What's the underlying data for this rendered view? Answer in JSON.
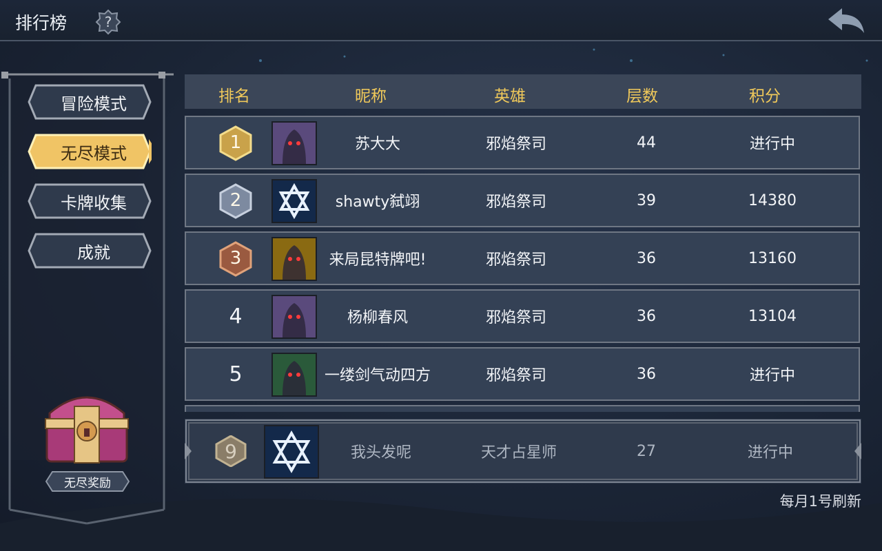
{
  "header": {
    "title": "排行榜",
    "help_icon": "question-gear-icon",
    "back_icon": "back-arrow-icon"
  },
  "sidebar": {
    "items": [
      {
        "label": "冒险模式",
        "active": false
      },
      {
        "label": "无尽模式",
        "active": true
      },
      {
        "label": "卡牌收集",
        "active": false
      },
      {
        "label": "成就",
        "active": false
      }
    ],
    "reward_label": "无尽奖励"
  },
  "table": {
    "columns": [
      "排名",
      "昵称",
      "英雄",
      "层数",
      "积分"
    ],
    "rows": [
      {
        "rank": "1",
        "nickname": "苏大大",
        "hero": "邪焰祭司",
        "floors": "44",
        "score": "进行中"
      },
      {
        "rank": "2",
        "nickname": "shawty弑翊",
        "hero": "邪焰祭司",
        "floors": "39",
        "score": "14380"
      },
      {
        "rank": "3",
        "nickname": "来局昆特牌吧!",
        "hero": "邪焰祭司",
        "floors": "36",
        "score": "13160"
      },
      {
        "rank": "4",
        "nickname": "杨柳春风",
        "hero": "邪焰祭司",
        "floors": "36",
        "score": "13104"
      },
      {
        "rank": "5",
        "nickname": "一缕剑气动四方",
        "hero": "邪焰祭司",
        "floors": "36",
        "score": "进行中"
      }
    ],
    "my_row": {
      "rank": "9",
      "nickname": "我头发呢",
      "hero": "天才占星师",
      "floors": "27",
      "score": "进行中"
    }
  },
  "footer": {
    "refresh_note": "每月1号刷新"
  },
  "colors": {
    "accent_gold": "#f0c95a",
    "row_bg": "#344155",
    "header_bg": "#3b4658"
  }
}
